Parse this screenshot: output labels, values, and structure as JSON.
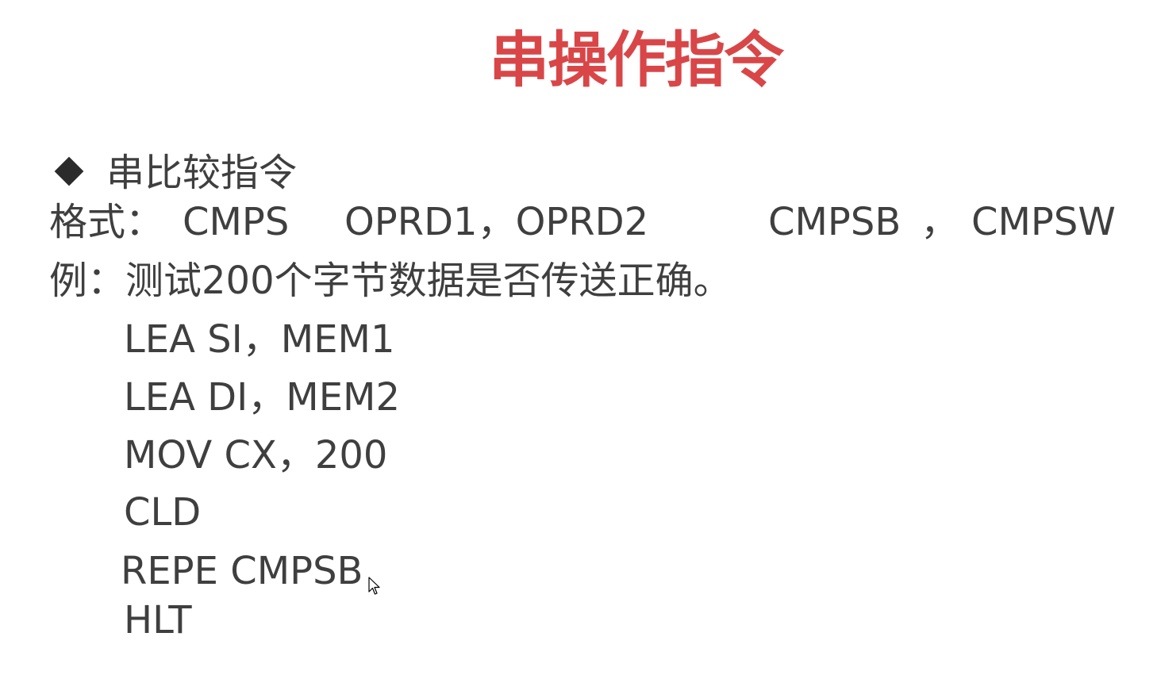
{
  "slide": {
    "title": "串操作指令",
    "bullet": {
      "icon": "diamond-bullet-icon",
      "label": "串比较指令"
    },
    "format": {
      "label": "格式：",
      "instruction": "CMPS",
      "operands": "OPRD1，OPRD2",
      "variant_byte": "CMPSB",
      "separator": "，",
      "variant_word": "CMPSW"
    },
    "example": {
      "text": "例：测试200个字节数据是否传送正确。"
    },
    "code_lines": [
      "LEA  SI，MEM1",
      "LEA  DI，MEM2",
      "MOV  CX，200",
      "CLD",
      "REPE   CMPSB",
      "HLT"
    ],
    "colors": {
      "title": "#d94648",
      "text": "#3f3f3f",
      "background": "#ffffff"
    }
  }
}
